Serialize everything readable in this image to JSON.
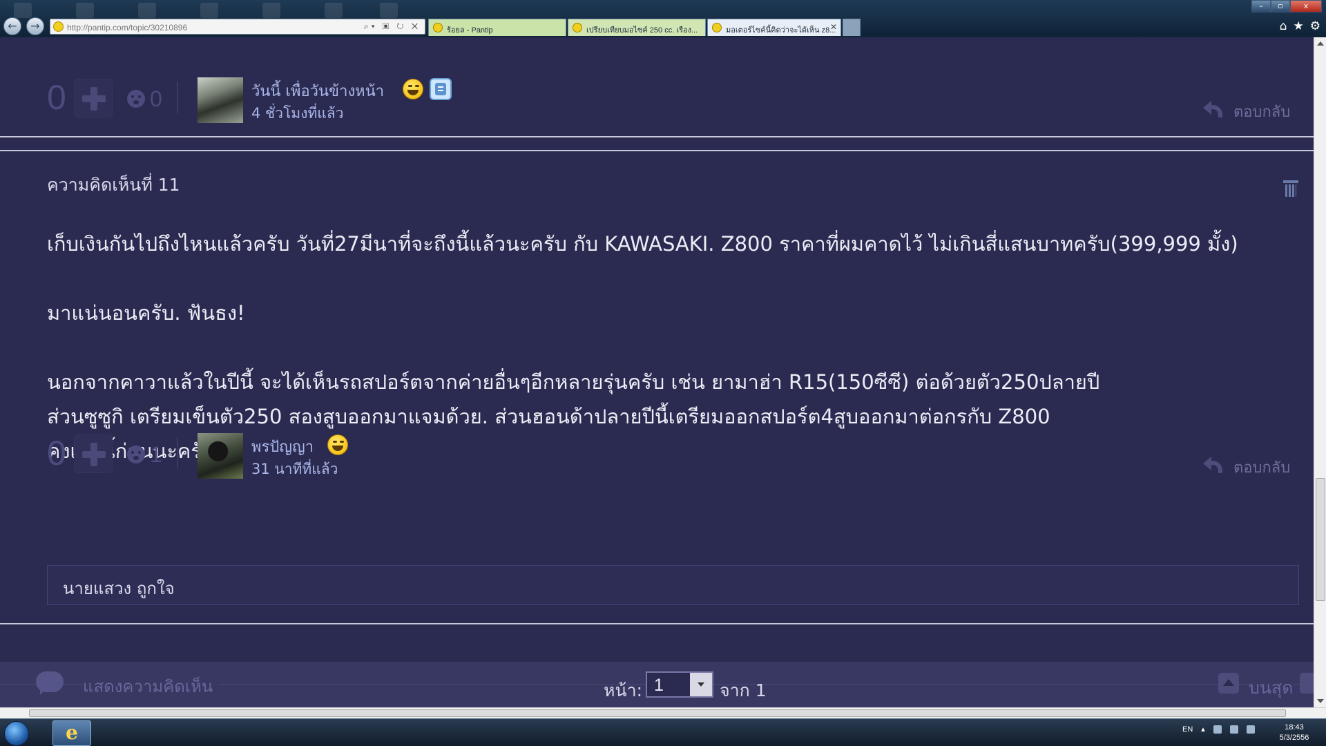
{
  "browser": {
    "url": "http://pantip.com/topic/30210896",
    "tabs": [
      {
        "label": "ร้อยล - Pantip"
      },
      {
        "label": "เปรียบเทียบมอไซค์ 250 cc. เรือง..."
      },
      {
        "label": "มอเตอร์ไซค์นี้คิดว่าจะได้เห็น z8..."
      }
    ],
    "window_controls": [
      "–",
      "▫",
      "x"
    ]
  },
  "post_previous": {
    "score": "0",
    "emotion_count": "0",
    "author": "วันนี้ เพื่อวันข้างหน้า",
    "time": "4 ชั่วโมงที่แล้ว",
    "reply_label": "ตอบกลับ"
  },
  "comment": {
    "title": "ความคิดเห็นที่ 11",
    "paragraphs": [
      [
        "เก็บเงินกันไปถึงไหนแล้วครับ วันที่27มีนาที่จะถึงนี้แล้วนะครับ กับ KAWASAKI. Z800 ราคาที่ผมคาดไว้ ไม่เกินสี่แสนบาทครับ(399,999 มั้ง)"
      ],
      [
        "มาแน่นอนครับ. ฟันธง!"
      ],
      [
        "นอกจากคาวาแล้วในปีนี้ จะได้เห็นรถสปอร์ตจากค่ายอื่นๆอีกหลายรุ่นครับ เช่น ยามาฮ่า R15(150ซีซี) ต่อด้วยตัว250ปลายปี",
        "ส่วนซูซูกิ เตรียมเข็นตัว250 สองสูบออกมาแจมด้วย. ส่วนฮอนด้าปลายปีนี้เตรียมออกสปอร์ต4สูบออกมาต่อกรกับ Z800",
        "คงเท่านี้ก่อนนะครับ"
      ]
    ],
    "score": "0",
    "emotion_count": "1",
    "author": "พรปัญญา",
    "time": "31 นาทีที่แล้ว",
    "reply_label": "ตอบกลับ",
    "sub_comment": "นายแสวง ถูกใจ"
  },
  "footer": {
    "comment_prompt": "แสดงความคิดเห็น",
    "page_label": "หน้า:",
    "page_value": "1",
    "page_total": "จาก 1",
    "top_label": "บนสุด"
  },
  "taskbar": {
    "language": "EN",
    "time": "18:43",
    "date": "5/3/2556"
  },
  "colors": {
    "page_background": "#2b2b51",
    "username": "#a9b6e8",
    "muted": "#4b4b7d"
  }
}
